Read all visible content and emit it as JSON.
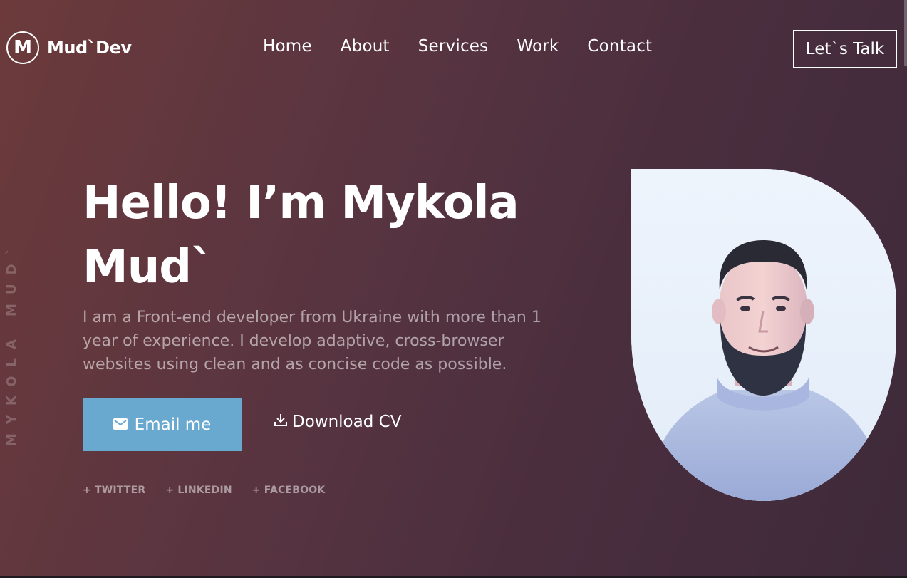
{
  "brand": {
    "logo_letter": "M",
    "name": "Mud`Dev"
  },
  "nav": {
    "items": [
      "Home",
      "About",
      "Services",
      "Work",
      "Contact"
    ]
  },
  "header": {
    "cta_label": "Let`s Talk"
  },
  "side_text": "MYKOLA MUD`",
  "hero": {
    "title": "Hello! I’m Mykola Mud`",
    "description": "I am a Front-end developer from Ukraine with more than 1 year of experience. I develop adaptive, cross-browser websites using clean and as concise code as possible.",
    "email_button": "Email me",
    "download_button": "Download CV",
    "socials": [
      "+ TWITTER",
      "+ LINKEDIN",
      "+ FACEBOOK"
    ]
  },
  "icons": {
    "email": "mail-icon",
    "download": "download-icon"
  },
  "colors": {
    "accent": "#6aa9cf",
    "text": "#ffffff"
  }
}
